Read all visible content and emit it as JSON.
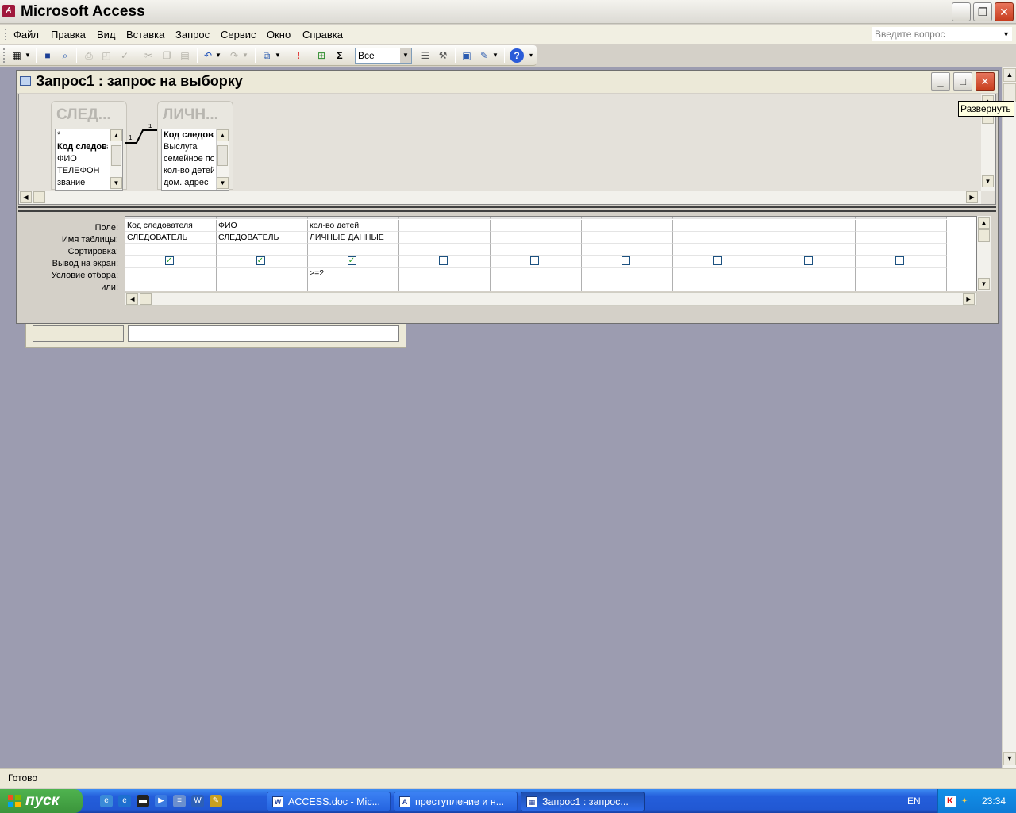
{
  "app": {
    "title": "Microsoft Access",
    "icon": "access-icon"
  },
  "menu": {
    "items": [
      "Файл",
      "Правка",
      "Вид",
      "Вставка",
      "Запрос",
      "Сервис",
      "Окно",
      "Справка"
    ],
    "help_placeholder": "Введите вопрос"
  },
  "toolbar": {
    "top_values_combo": "Все",
    "totals_symbol": "Σ",
    "run_symbol": "!"
  },
  "query_window": {
    "title": "Запрос1 : запрос на выборку",
    "tables": [
      {
        "title": "СЛЕД...",
        "fields": [
          "*",
          "Код следователя",
          "ФИО",
          "ТЕЛЕФОН",
          "звание"
        ],
        "bold_index": 1
      },
      {
        "title": "ЛИЧН...",
        "fields": [
          "Код следователя",
          "Выслуга",
          "семейное положение",
          "кол-во детей",
          "дом. адрес"
        ],
        "bold_index": 0
      }
    ],
    "relationship": {
      "left_mark": "1",
      "right_mark": "1"
    },
    "row_labels": [
      "Поле:",
      "Имя таблицы:",
      "Сортировка:",
      "Вывод на экран:",
      "Условие отбора:",
      "или:"
    ],
    "columns": [
      {
        "field": "Код следователя",
        "table": "СЛЕДОВАТЕЛЬ",
        "sort": "",
        "show": true,
        "criteria": "",
        "or": ""
      },
      {
        "field": "ФИО",
        "table": "СЛЕДОВАТЕЛЬ",
        "sort": "",
        "show": true,
        "criteria": "",
        "or": ""
      },
      {
        "field": "кол-во детей",
        "table": "ЛИЧНЫЕ ДАННЫЕ",
        "sort": "",
        "show": true,
        "criteria": ">=2",
        "or": ""
      },
      {
        "field": "",
        "table": "",
        "sort": "",
        "show": false,
        "criteria": "",
        "or": ""
      },
      {
        "field": "",
        "table": "",
        "sort": "",
        "show": false,
        "criteria": "",
        "or": ""
      },
      {
        "field": "",
        "table": "",
        "sort": "",
        "show": false,
        "criteria": "",
        "or": ""
      },
      {
        "field": "",
        "table": "",
        "sort": "",
        "show": false,
        "criteria": "",
        "or": ""
      },
      {
        "field": "",
        "table": "",
        "sort": "",
        "show": false,
        "criteria": "",
        "or": ""
      },
      {
        "field": "",
        "table": "",
        "sort": "",
        "show": false,
        "criteria": "",
        "or": ""
      }
    ]
  },
  "tooltip": "Развернуть",
  "status": "Готово",
  "taskbar": {
    "start_label": "пуск",
    "tasks": [
      {
        "label": "ACCESS.doc - Mic...",
        "icon": "word-doc-icon",
        "active": false
      },
      {
        "label": "преступление и н...",
        "icon": "access-db-icon",
        "active": false
      },
      {
        "label": "Запрос1 : запрос...",
        "icon": "query-icon",
        "active": true
      }
    ],
    "language": "EN",
    "clock": "23:34"
  }
}
